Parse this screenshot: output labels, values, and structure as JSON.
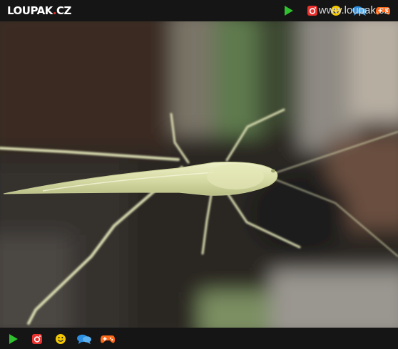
{
  "header": {
    "logo_main": "LOUPAK",
    "logo_dot": ".",
    "logo_tld": "CZ"
  },
  "icons": {
    "play": "play-icon",
    "instagram": "instagram-icon",
    "smiley": "smiley-icon",
    "chat": "chat-bubbles-icon",
    "gamepad": "gamepad-icon"
  },
  "colors": {
    "play": "#2fbf2f",
    "instagram": "#e8322f",
    "smiley": "#f5c800",
    "chat": "#2e8fe0",
    "gamepad": "#ff6a1a"
  },
  "footer": {
    "url": "www.loupak.cz"
  }
}
